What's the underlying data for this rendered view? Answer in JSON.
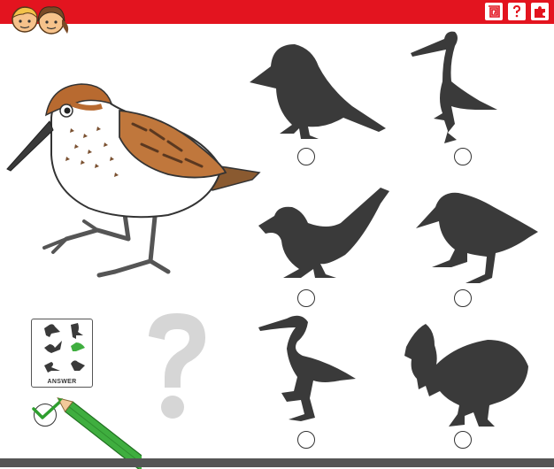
{
  "header": {
    "bar_color": "#e3141f"
  },
  "icons": [
    "kids-avatar-icon",
    "spiral-maze-icon",
    "question-mark-icon",
    "puzzle-piece-icon"
  ],
  "answer_card": {
    "label": "ANSWER"
  },
  "colors": {
    "shadow": "#3a3a3a",
    "check": "#2e9e2e",
    "pencil": "#3fae3f"
  }
}
